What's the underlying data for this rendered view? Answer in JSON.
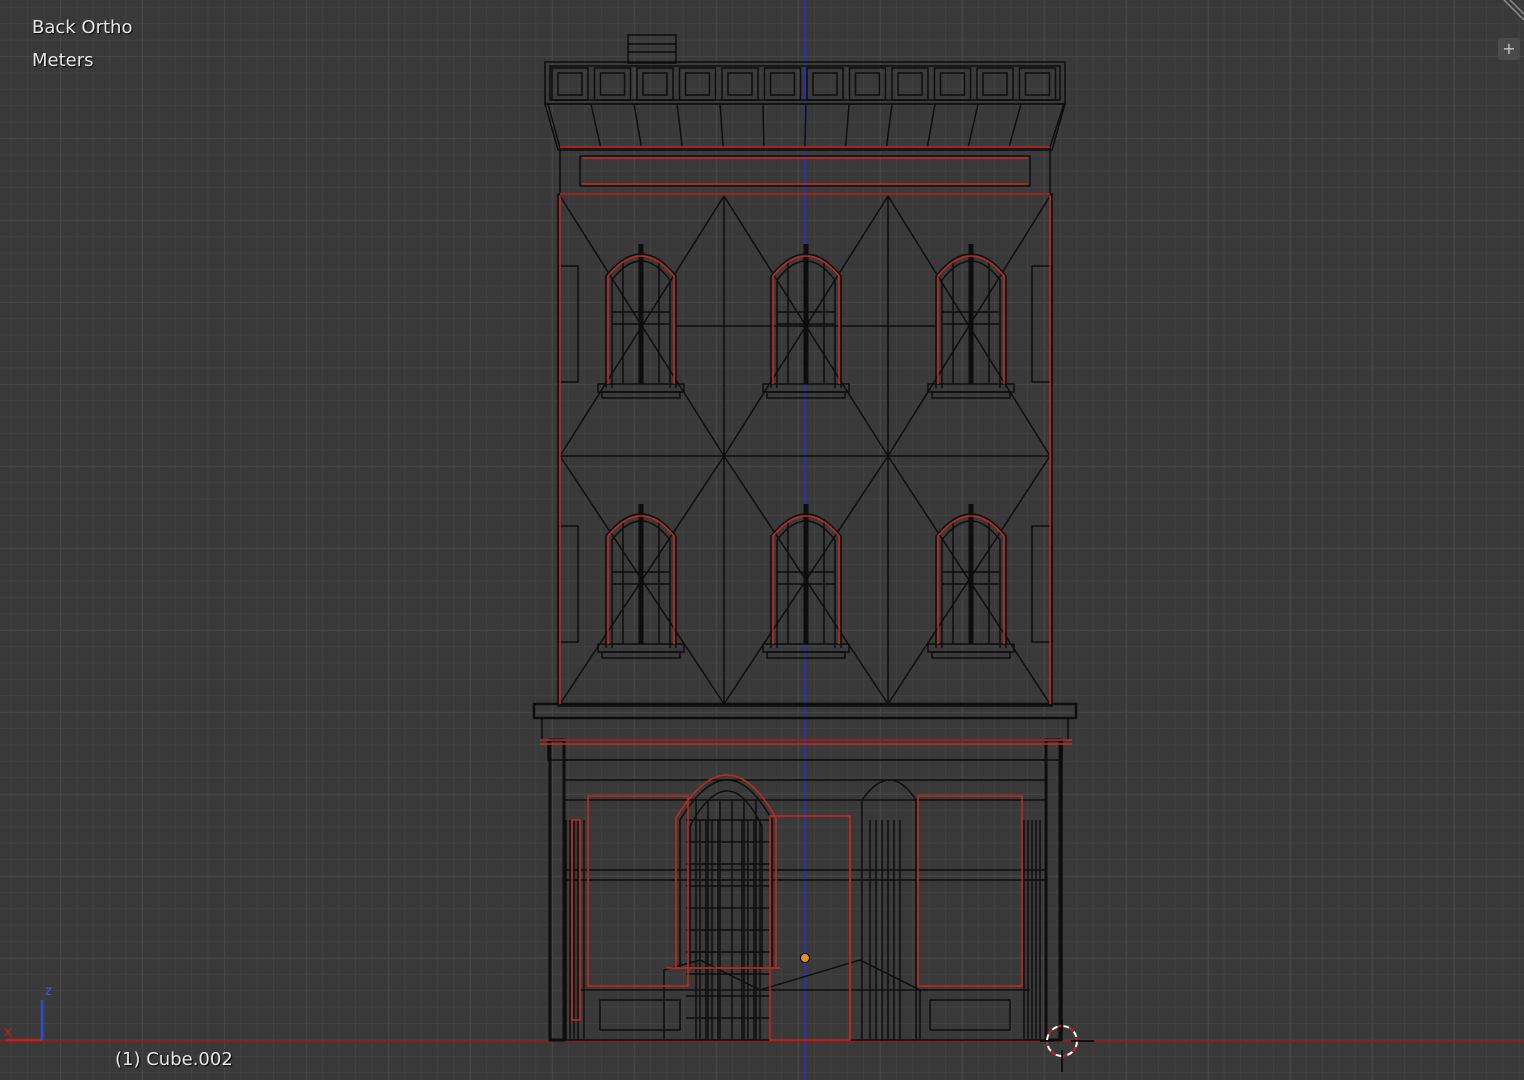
{
  "viewport": {
    "view_name": "Back Ortho",
    "unit_label": "Meters",
    "object_info": "(1) Cube.002",
    "axis_labels": {
      "x": "x",
      "z": "z"
    },
    "widgets": {
      "add_region": "+"
    }
  },
  "colors": {
    "background": "#393939",
    "grid": "#454545",
    "wire": "#0d0d0d",
    "selected_edge": "#c8281c",
    "vertical_axis": "#2a2ad0",
    "horizontal_axis": "#a01818",
    "origin": "#e5902f"
  }
}
